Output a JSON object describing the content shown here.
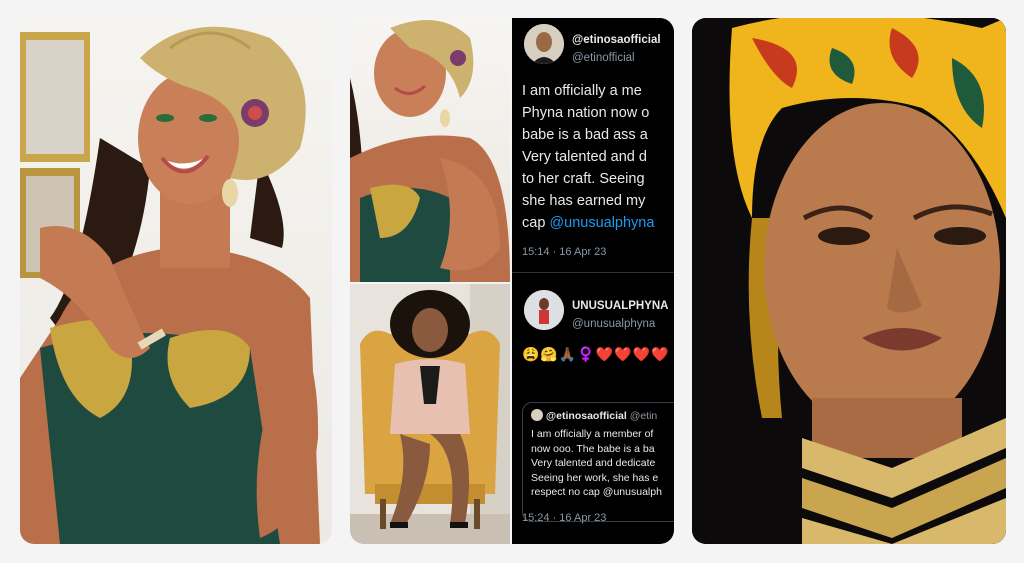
{
  "tweet1": {
    "display_name": "@etinosaofficial",
    "handle": "@etinofficial",
    "lines": [
      "I am officially a me",
      "Phyna nation now o",
      "babe is a bad ass a",
      "Very talented and d",
      "to her craft. Seeing",
      "she has earned my"
    ],
    "last_line_prefix": "cap ",
    "last_line_mention": "@unusualphyna",
    "timestamp": "15:14 · 16 Apr 23"
  },
  "tweet2": {
    "display_name": "UNUSUALPHYNA",
    "handle": "@unusualphyna",
    "emojis": "😩🤗🙏🏾♀️❤️❤️❤️❤️",
    "quote": {
      "display_name": "@etinosaofficial",
      "handle": "@etin",
      "lines": [
        "I am officially a member of",
        "now ooo. The babe is a ba",
        "Very talented and dedicate",
        "Seeing her work, she has e"
      ],
      "last_line_prefix": "respect no cap ",
      "last_line_mention": "@unusualph"
    },
    "timestamp": "15:24 · 16 Apr 23"
  },
  "colors": {
    "background": "#f4f4f4",
    "tweet_bg": "#000000",
    "mention": "#1d9bf0",
    "secondary_text": "#8b98a5",
    "gele_gold": "#cdb26f",
    "velvet_green": "#1f4a40",
    "headwrap_yellow": "#f0b51c"
  }
}
